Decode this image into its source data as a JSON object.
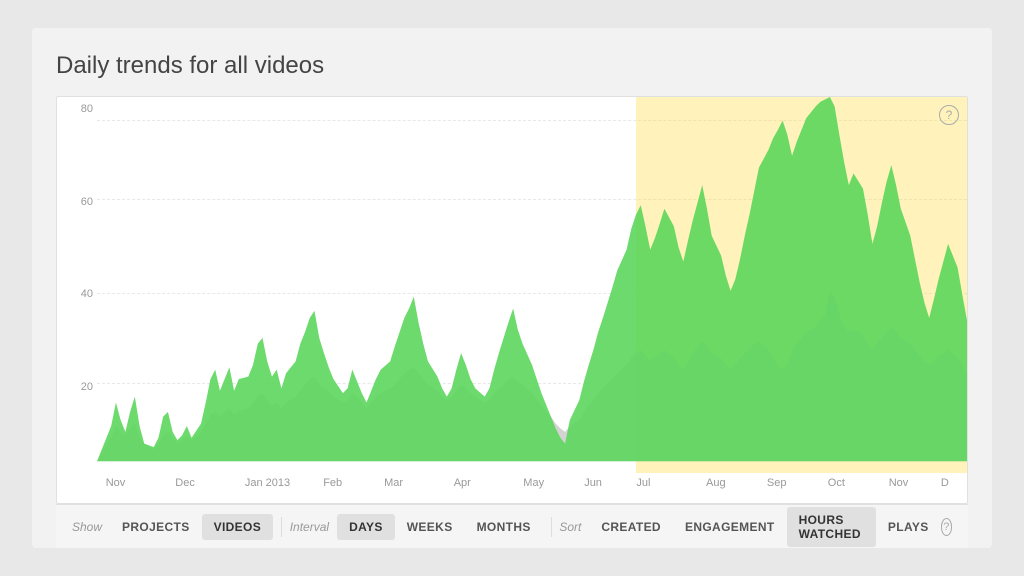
{
  "page": {
    "title": "Daily trends for all videos",
    "background": "#e8e8e8"
  },
  "chart": {
    "y_labels": [
      "80",
      "60",
      "40",
      "20"
    ],
    "x_labels": [
      {
        "text": "Nov",
        "pct": 2
      },
      {
        "text": "Dec",
        "pct": 10
      },
      {
        "text": "Jan 2013",
        "pct": 18
      },
      {
        "text": "Feb",
        "pct": 26
      },
      {
        "text": "Mar",
        "pct": 32
      },
      {
        "text": "Apr",
        "pct": 40
      },
      {
        "text": "May",
        "pct": 48
      },
      {
        "text": "Jun",
        "pct": 56
      },
      {
        "text": "Jul",
        "pct": 62
      },
      {
        "text": "Aug",
        "pct": 70
      },
      {
        "text": "Sep",
        "pct": 77
      },
      {
        "text": "Oct",
        "pct": 84
      },
      {
        "text": "Nov",
        "pct": 91
      },
      {
        "text": "D",
        "pct": 98
      }
    ],
    "highlight": {
      "start_pct": 62,
      "end_pct": 100
    },
    "help_label": "?"
  },
  "toolbar": {
    "show_label": "Show",
    "interval_label": "Interval",
    "sort_label": "Sort",
    "buttons": {
      "projects": "PROJECTS",
      "videos": "VIDEOS",
      "days": "DAYS",
      "weeks": "WEEKS",
      "months": "MONTHS",
      "created": "CREATED",
      "engagement": "ENGAGEMENT",
      "hours_watched": "HOURS WATCHED",
      "plays": "PLAYS"
    },
    "active": {
      "show": "videos",
      "interval": "days",
      "sort": "hours_watched"
    },
    "help_label": "?"
  }
}
